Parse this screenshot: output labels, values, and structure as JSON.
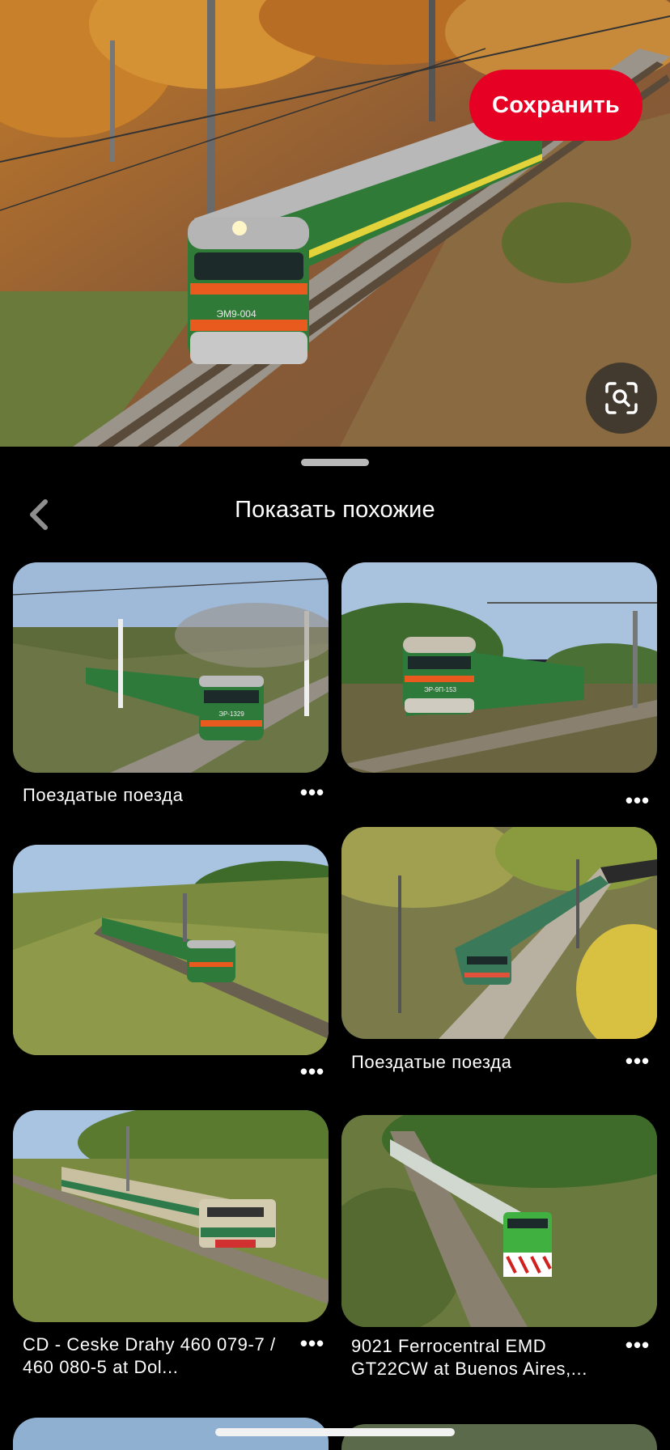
{
  "colors": {
    "brand_red": "#e60023",
    "background": "#000000"
  },
  "hero": {
    "save_label": "Сохранить",
    "lens_icon": "visual-search-icon",
    "train_plate": "ЭМ9-004"
  },
  "sheet": {
    "back_icon": "chevron-left-icon",
    "title": "Показать похожие"
  },
  "pins": [
    {
      "caption": "Поездатые поезда",
      "plate": "ЭР-1329"
    },
    {
      "caption": "",
      "plate": "ЭР-9П-153"
    },
    {
      "caption": ""
    },
    {
      "caption": "Поездатые поезда"
    },
    {
      "caption": "CD - Ceske Drahy 460 079-7 / 460 080-5  at Dol..."
    },
    {
      "caption": "9021 Ferrocentral EMD GT22CW at Buenos Aires,..."
    }
  ],
  "more_glyph": "•••"
}
